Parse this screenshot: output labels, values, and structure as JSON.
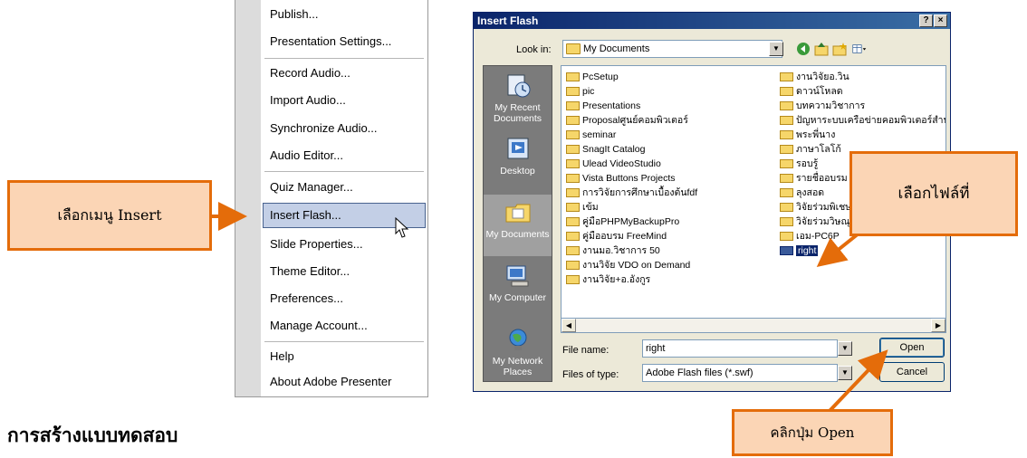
{
  "menu": {
    "items": [
      {
        "label": "Publish..."
      },
      {
        "label": "Presentation Settings..."
      },
      {
        "label": "Record Audio..."
      },
      {
        "label": "Import Audio..."
      },
      {
        "label": "Synchronize Audio..."
      },
      {
        "label": "Audio Editor..."
      },
      {
        "label": "Quiz Manager..."
      },
      {
        "label": "Insert Flash..."
      },
      {
        "label": "Slide Properties..."
      },
      {
        "label": "Theme Editor..."
      },
      {
        "label": "Preferences..."
      },
      {
        "label": "Manage Account..."
      },
      {
        "label": "Help"
      },
      {
        "label": "About Adobe Presenter"
      }
    ],
    "highlighted": "Insert Flash..."
  },
  "dialog": {
    "title": "Insert Flash",
    "help_button": "?",
    "close_button": "×",
    "look_in_label": "Look in:",
    "look_in_value": "My Documents",
    "places": [
      {
        "label": "My Recent Documents",
        "icon": "recent-documents-icon"
      },
      {
        "label": "Desktop",
        "icon": "desktop-icon"
      },
      {
        "label": "My Documents",
        "icon": "my-documents-icon"
      },
      {
        "label": "My Computer",
        "icon": "my-computer-icon"
      },
      {
        "label": "My Network Places",
        "icon": "network-places-icon"
      }
    ],
    "files_col1": [
      "PcSetup",
      "pic",
      "Presentations",
      "Proposalศูนย์คอมพิวเตอร์",
      "seminar",
      "SnagIt Catalog",
      "Ulead VideoStudio",
      "Vista Buttons Projects",
      "การวิจัยการศึกษาเบื้องต้นfdf",
      "เข้ม",
      "คู่มือPHPMyBackupPro",
      "คู่มืออบรม FreeMind",
      "งานมอ.วิชาการ 50",
      "งานวิจัย VDO on Demand",
      "งานวิจัย+อ.อังกูร"
    ],
    "files_col2": [
      "งานวิจัยอ.วิน",
      "ดาวน์โหลด",
      "บทความวิชาการ",
      "ปัญหาระบบเครือข่ายคอมพิวเตอร์สำนัก",
      "พระพี่นาง",
      "ภาษาโลโก้",
      "รอบรู้",
      "รายชื่ออบรม",
      "ลุงสอด",
      "วิจัยร่วมพิเชษฐ",
      "วิจัยร่วมวิษณุ",
      "เอม-PC6P",
      "right"
    ],
    "selected_file": "right",
    "file_name_label": "File name:",
    "file_name_value": "right",
    "file_type_label": "Files of type:",
    "file_type_value": "Adobe Flash files (*.swf)",
    "open_button": "Open",
    "cancel_button": "Cancel"
  },
  "callouts": {
    "insert_menu": "เลือกเมนู Insert",
    "choose_file": "เลือกไฟล์ที่",
    "click_open": "คลิกปุ่ม Open"
  },
  "heading": "การสร้างแบบทดสอบ",
  "colors": {
    "callout_fill": "#fbd5b5",
    "callout_border": "#e46c0a",
    "highlight": "#c3cfe6",
    "titlebar": "#0a246a"
  }
}
